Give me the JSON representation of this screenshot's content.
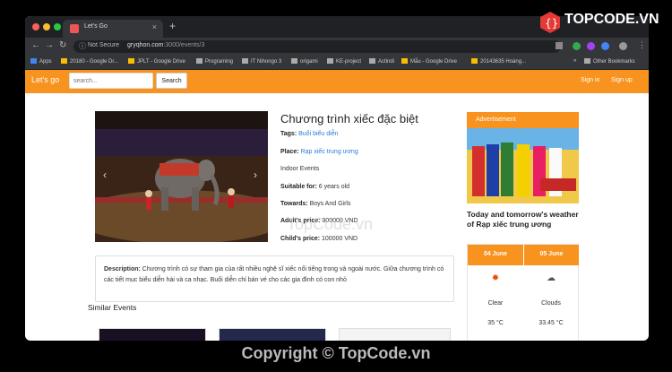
{
  "browser": {
    "tab_title": "Let's Go",
    "not_secure": "Not Secure",
    "url_host": "gryqhon.com",
    "url_path": ":3000/events/3",
    "bookmarks": [
      "Apps",
      "20180 - Google Dr...",
      "JPLT - Google Drive",
      "Programing",
      "IT Nihongo 3",
      "origami",
      "KE-project",
      "Actindi",
      "Mẫu - Google Drive",
      "20143635 Hoàng...",
      "Other Bookmarks"
    ]
  },
  "site": {
    "brand": "Let's go",
    "search_placeholder": "search...",
    "search_button": "Search",
    "sign_in": "Sign in",
    "sign_up": "Sign up"
  },
  "event": {
    "title": "Chương trình xiếc đặc biệt",
    "tags_label": "Tags:",
    "tags_value": "Buổi biểu diễn",
    "place_label": "Place:",
    "place_value": "Rạp xiếc trung ương",
    "type": "Indoor Events",
    "suitable_label": "Suitable for:",
    "suitable_value": "6 years old",
    "towards_label": "Towards:",
    "towards_value": "Boys And Girls",
    "adult_label": "Adult's price:",
    "adult_value": "300000 VND",
    "child_label": "Child's price:",
    "child_value": "100000 VND",
    "desc_label": "Description:",
    "desc_text": "Chương trình có sự tham gia của rất nhiều nghệ sĩ xiếc nổi tiếng trong và ngoài nước. Giữa chương trình có các tiết mục biểu diễn hài và ca nhạc. Buổi diễn chỉ bán vé cho các gia đình có con nhỏ"
  },
  "similar_title": "Similar Events",
  "ad": {
    "title": "Advertisement"
  },
  "weather": {
    "title": "Today and tomorrow's weather of Rạp xiếc trung ương",
    "days": [
      {
        "date": "04 June",
        "condition": "Clear",
        "temp": "35 °C",
        "icon": "sun-icon"
      },
      {
        "date": "05 June",
        "condition": "Clouds",
        "temp": "33.45 °C",
        "icon": "cloud-icon"
      }
    ]
  },
  "watermark": {
    "brand": "TOPCODE.VN",
    "center": "TopCode.vn",
    "copyright": "Copyright © TopCode.vn"
  },
  "colors": {
    "accent": "#f7931e",
    "link": "#2b7bd6"
  }
}
